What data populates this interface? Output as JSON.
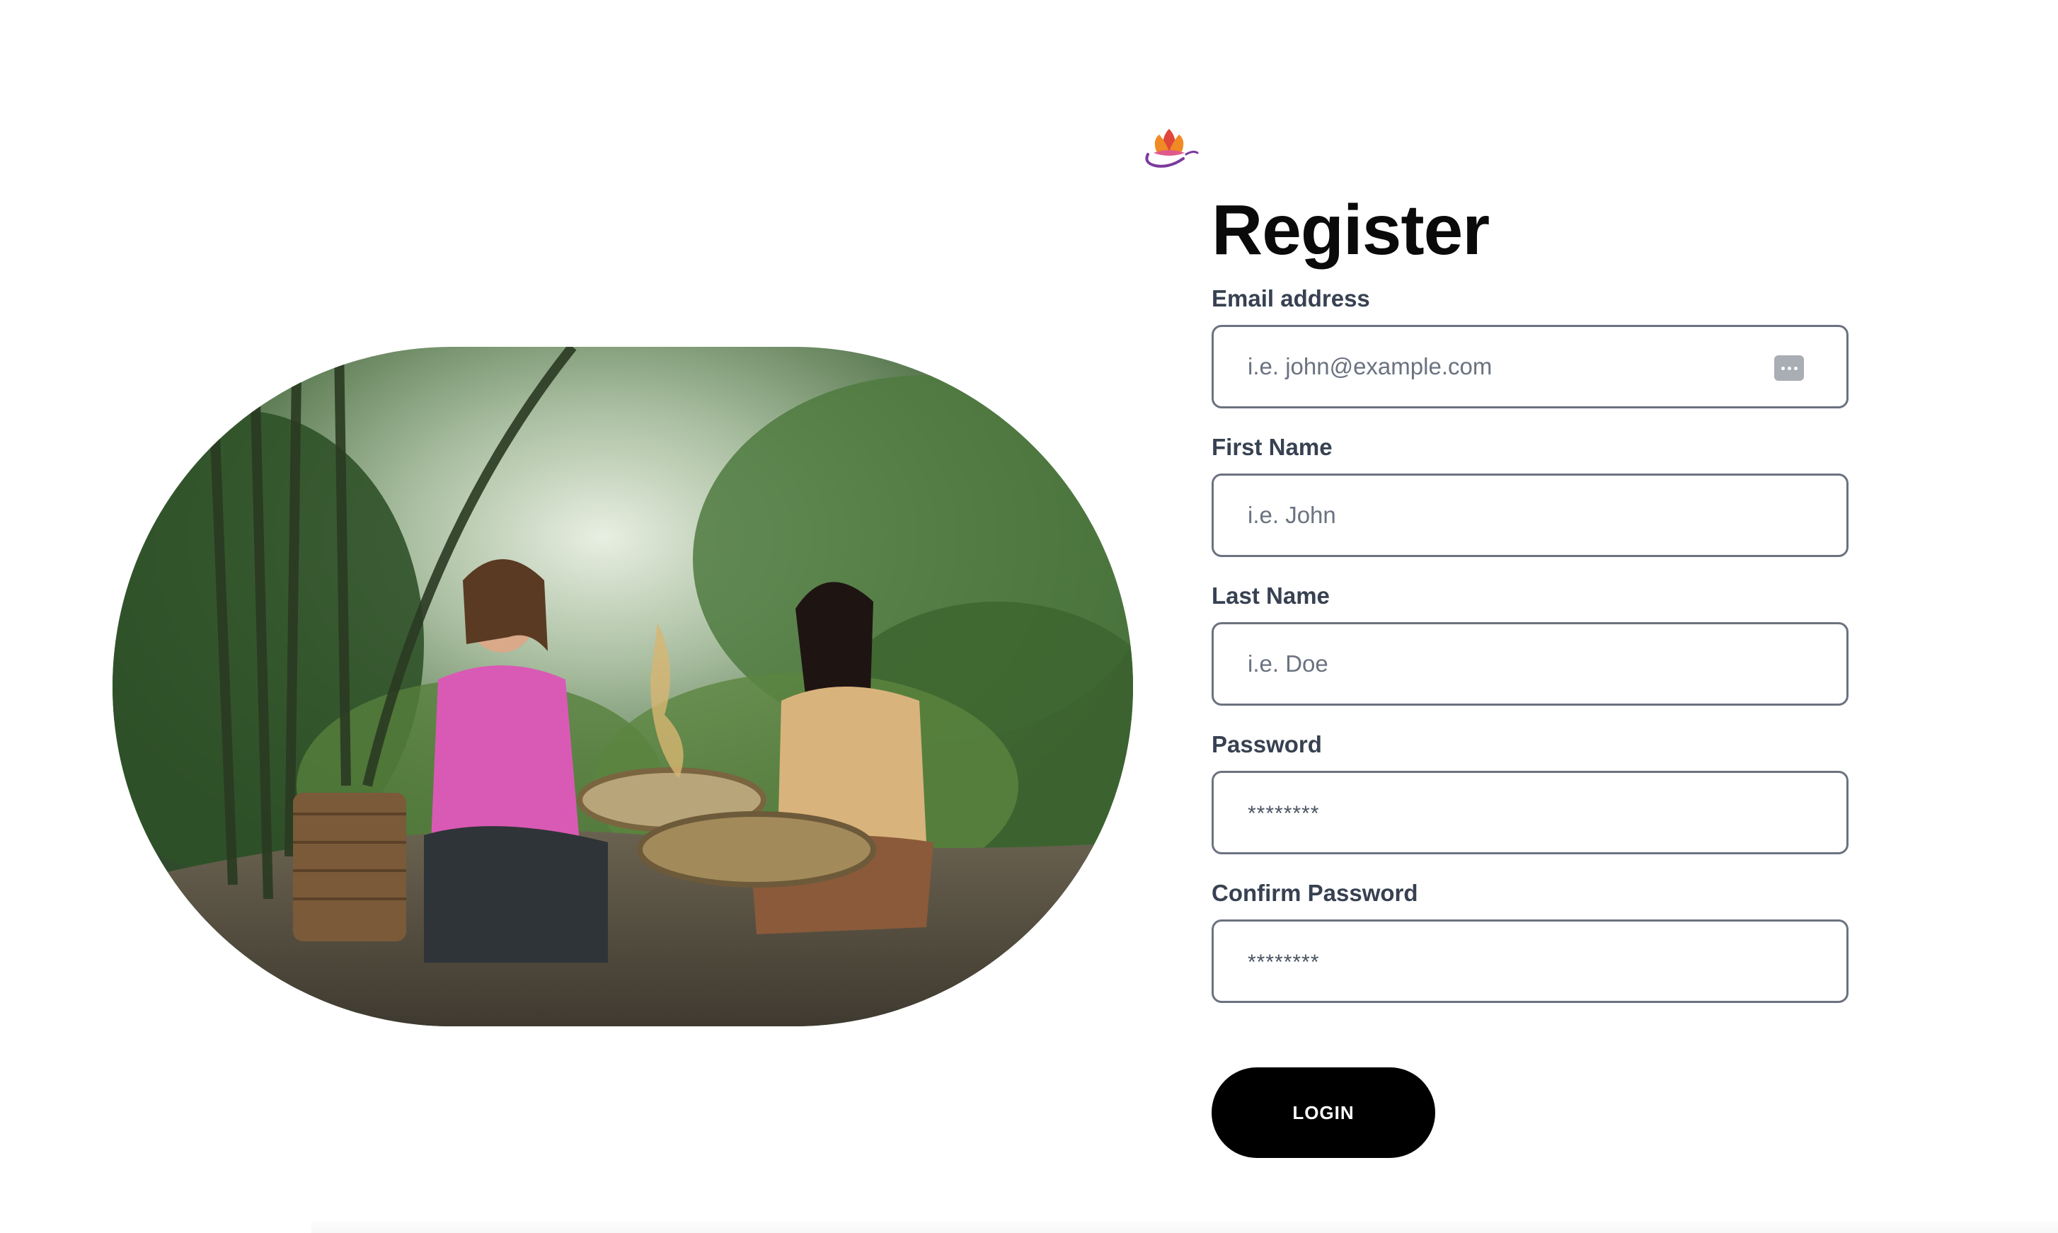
{
  "form": {
    "title": "Register",
    "fields": [
      {
        "label": "Email address",
        "placeholder": "i.e. john@example.com"
      },
      {
        "label": "First Name",
        "placeholder": "i.e. John"
      },
      {
        "label": "Last Name",
        "placeholder": "i.e. Doe"
      },
      {
        "label": "Password",
        "placeholder": "********"
      },
      {
        "label": "Confirm Password",
        "placeholder": "********"
      }
    ],
    "submit_label": "LOGIN"
  },
  "hero": {
    "icon": "photo-two-women-winnowing-rice-in-bamboo-forest"
  },
  "logo": {
    "icon": "lotus-logo-icon",
    "colors": [
      "#e0463a",
      "#f08a24",
      "#7a3b9c"
    ]
  },
  "colors": {
    "button_bg": "#000000",
    "input_border": "#6b7280",
    "label": "#374151"
  }
}
